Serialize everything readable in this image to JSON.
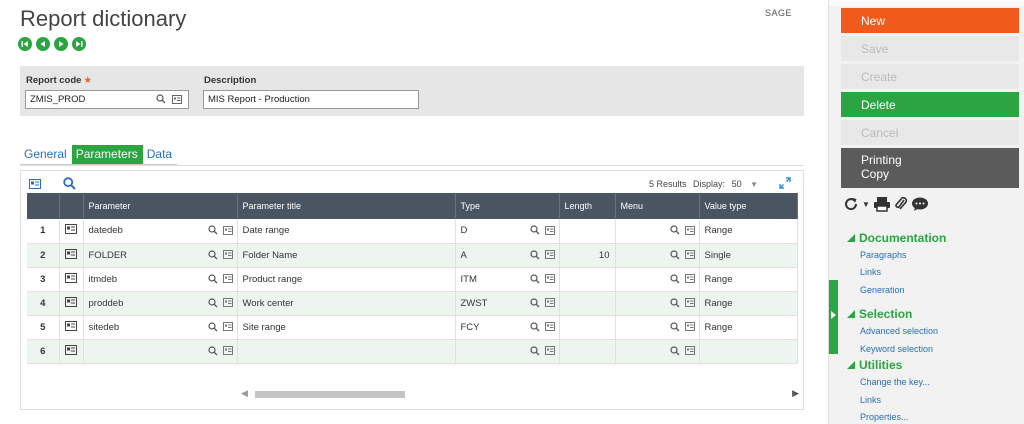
{
  "page": {
    "title": "Report dictionary",
    "folder": "SAGE"
  },
  "form": {
    "report_code_label": "Report code",
    "report_code_value": "ZMIS_PROD",
    "description_label": "Description",
    "description_value": "MIS Report - Production"
  },
  "tabs": [
    {
      "label": "General"
    },
    {
      "label": "Parameters"
    },
    {
      "label": "Data"
    }
  ],
  "grid": {
    "results_text": "5 Results",
    "display_label": "Display:",
    "display_value": "50",
    "columns": [
      "Parameter",
      "Parameter title",
      "Type",
      "Length",
      "Menu",
      "Value type"
    ],
    "rows": [
      {
        "num": "1",
        "parameter": "datedeb",
        "title": "Date range",
        "type": "D",
        "length": "",
        "menu": "",
        "value_type": "Range"
      },
      {
        "num": "2",
        "parameter": "FOLDER",
        "title": "Folder Name",
        "type": "A",
        "length": "10",
        "menu": "",
        "value_type": "Single"
      },
      {
        "num": "3",
        "parameter": "itmdeb",
        "title": "Product range",
        "type": "ITM",
        "length": "",
        "menu": "",
        "value_type": "Range"
      },
      {
        "num": "4",
        "parameter": "proddeb",
        "title": "Work center",
        "type": "ZWST",
        "length": "",
        "menu": "",
        "value_type": "Range"
      },
      {
        "num": "5",
        "parameter": "sitedeb",
        "title": "Site range",
        "type": "FCY",
        "length": "",
        "menu": "",
        "value_type": "Range"
      },
      {
        "num": "6",
        "parameter": "",
        "title": "",
        "type": "",
        "length": "",
        "menu": "",
        "value_type": ""
      }
    ]
  },
  "actions": {
    "new": "New",
    "save": "Save",
    "create": "Create",
    "delete": "Delete",
    "cancel": "Cancel",
    "printing": "Printing",
    "copy": "Copy"
  },
  "sections": {
    "documentation": {
      "title": "Documentation",
      "links": [
        "Paragraphs",
        "Links",
        "Generation"
      ]
    },
    "selection": {
      "title": "Selection",
      "links": [
        "Advanced selection",
        "Keyword selection"
      ]
    },
    "utilities": {
      "title": "Utilities",
      "links": [
        "Change the key...",
        "Links",
        "Properties..."
      ]
    }
  },
  "colors": {
    "accent_green": "#2aa542",
    "new_orange": "#f05a1a",
    "header_dark": "#4b5562",
    "link_blue": "#2a6fb7"
  }
}
